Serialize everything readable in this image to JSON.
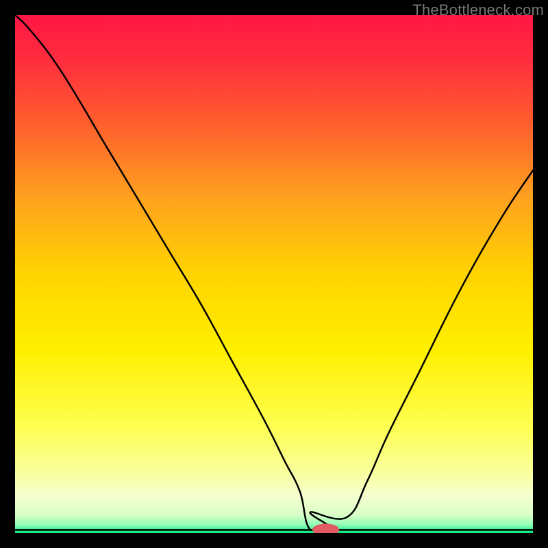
{
  "watermark": "TheBottleneck.com",
  "chart_data": {
    "type": "line",
    "title": "",
    "xlabel": "",
    "ylabel": "",
    "xlim": [
      0,
      100
    ],
    "ylim": [
      0,
      100
    ],
    "grid": false,
    "gradient_stops": [
      {
        "offset": 0.0,
        "color": "#ff1744"
      },
      {
        "offset": 0.08,
        "color": "#ff2b3f"
      },
      {
        "offset": 0.2,
        "color": "#ff5a2e"
      },
      {
        "offset": 0.35,
        "color": "#ffa01f"
      },
      {
        "offset": 0.5,
        "color": "#ffd400"
      },
      {
        "offset": 0.65,
        "color": "#fff000"
      },
      {
        "offset": 0.8,
        "color": "#fdff55"
      },
      {
        "offset": 0.88,
        "color": "#f9ff9a"
      },
      {
        "offset": 0.93,
        "color": "#f4ffcf"
      },
      {
        "offset": 0.965,
        "color": "#d9ffc6"
      },
      {
        "offset": 0.985,
        "color": "#8effb6"
      },
      {
        "offset": 1.0,
        "color": "#00e981"
      }
    ],
    "curve": {
      "x": [
        0,
        3,
        9,
        18,
        24,
        30,
        36,
        42,
        48,
        52,
        55,
        57,
        58.5,
        60,
        61,
        64,
        68,
        72,
        78,
        86,
        94,
        100
      ],
      "y": [
        100,
        97,
        89,
        74,
        64,
        54,
        44,
        33,
        22,
        14,
        8,
        4,
        1.2,
        0.6,
        0.6,
        3,
        10,
        19,
        31,
        47,
        61,
        70
      ]
    },
    "flat_segment": {
      "x0": 57.0,
      "x1": 61.5,
      "y": 0.6
    },
    "baseline_y": 0.6,
    "baseline_x": [
      0,
      100
    ],
    "marker": {
      "x": 60.0,
      "y": 0.6,
      "rx": 2.6,
      "ry": 1.2,
      "fill": "#e25a62"
    }
  }
}
